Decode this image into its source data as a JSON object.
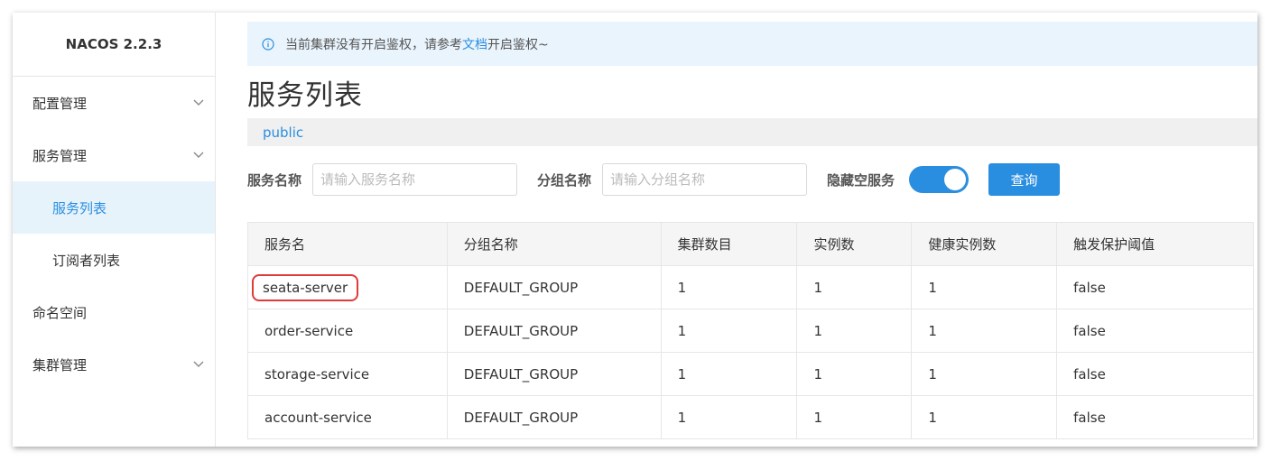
{
  "brand": "NACOS 2.2.3",
  "sidebar": {
    "items": [
      {
        "label": "配置管理"
      },
      {
        "label": "服务管理"
      },
      {
        "label": "服务列表"
      },
      {
        "label": "订阅者列表"
      },
      {
        "label": "命名空间"
      },
      {
        "label": "集群管理"
      }
    ]
  },
  "notice": {
    "text_before": "当前集群没有开启鉴权，请参考",
    "link": "文档",
    "text_after": "开启鉴权~"
  },
  "page_title": "服务列表",
  "namespace": "public",
  "filters": {
    "service_name_label": "服务名称",
    "service_name_placeholder": "请输入服务名称",
    "group_name_label": "分组名称",
    "group_name_placeholder": "请输入分组名称",
    "hide_empty_label": "隐藏空服务",
    "hide_empty_on": true,
    "query_button": "查询"
  },
  "table": {
    "headers": [
      "服务名",
      "分组名称",
      "集群数目",
      "实例数",
      "健康实例数",
      "触发保护阈值"
    ],
    "rows": [
      [
        "seata-server",
        "DEFAULT_GROUP",
        "1",
        "1",
        "1",
        "false"
      ],
      [
        "order-service",
        "DEFAULT_GROUP",
        "1",
        "1",
        "1",
        "false"
      ],
      [
        "storage-service",
        "DEFAULT_GROUP",
        "1",
        "1",
        "1",
        "false"
      ],
      [
        "account-service",
        "DEFAULT_GROUP",
        "1",
        "1",
        "1",
        "false"
      ]
    ]
  },
  "colors": {
    "accent": "#2a8ee0",
    "highlight_circle": "#e03a3a"
  }
}
